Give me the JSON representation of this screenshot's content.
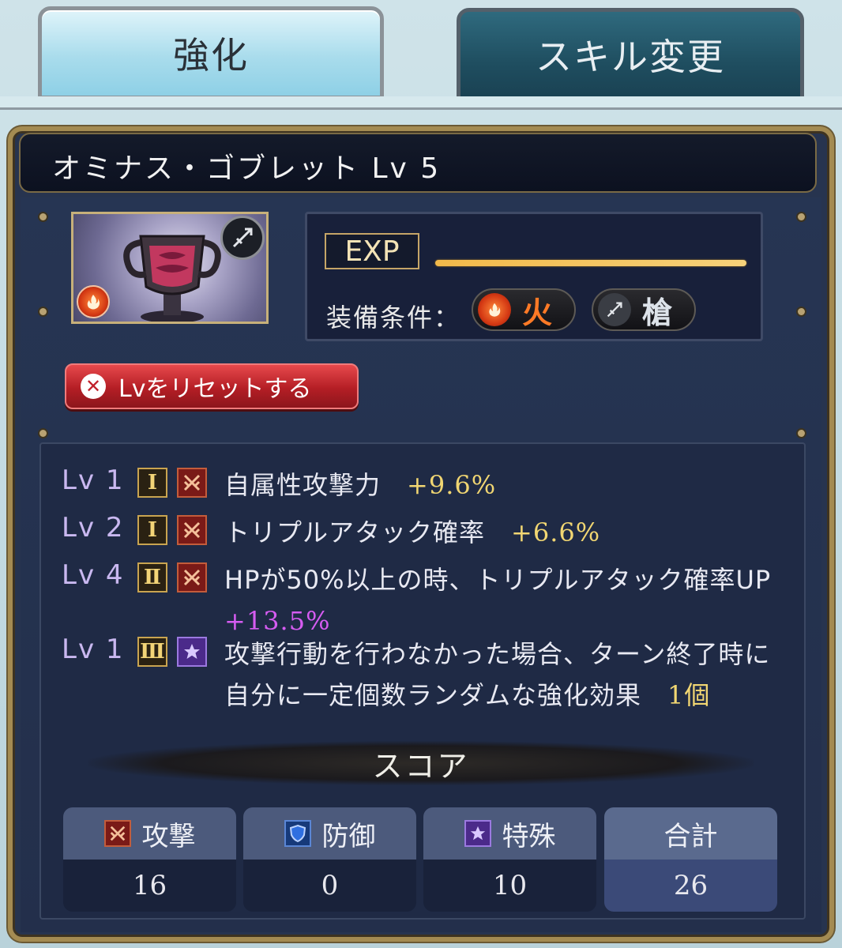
{
  "tabs": [
    {
      "label": "強化",
      "active": true
    },
    {
      "label": "スキル変更",
      "active": false
    }
  ],
  "item": {
    "name": "オミナス・ゴブレット Lv 5",
    "weapon_icon": "spear-icon",
    "element_icon": "fire-icon"
  },
  "exp": {
    "label": "EXP",
    "progress": 1.0
  },
  "equip": {
    "label": "装備条件：",
    "conditions": [
      {
        "icon": "fire-icon",
        "label": "火",
        "color": "#ff7a26"
      },
      {
        "icon": "spear-icon",
        "label": "槍",
        "color": "#dde3ea"
      }
    ]
  },
  "reset_button": {
    "label": "Lvをリセットする"
  },
  "skills": [
    {
      "level": "Lv 1",
      "rank": "Ⅰ",
      "type": "attack",
      "text": "自属性攻撃力",
      "value": "+9.6%",
      "value_color": "gold"
    },
    {
      "level": "Lv 2",
      "rank": "Ⅰ",
      "type": "attack",
      "text": "トリプルアタック確率",
      "value": "+6.6%",
      "value_color": "gold"
    },
    {
      "level": "Lv 4",
      "rank": "Ⅱ",
      "type": "attack",
      "text": "HPが50%以上の時、トリプルアタック確率UP",
      "value": "+13.5%",
      "value_color": "purple"
    },
    {
      "level": "Lv 1",
      "rank": "Ⅲ",
      "type": "special",
      "text": "攻撃行動を行わなかった場合、ターン終了時に自分に一定個数ランダムな強化効果",
      "value": "1個",
      "value_color": "gold"
    }
  ],
  "score": {
    "title": "スコア",
    "columns": [
      {
        "label": "攻撃",
        "icon": "attack-icon",
        "value": "16"
      },
      {
        "label": "防御",
        "icon": "shield-icon",
        "value": "0"
      },
      {
        "label": "特殊",
        "icon": "star-icon",
        "value": "10"
      },
      {
        "label": "合計",
        "icon": "",
        "value": "26"
      }
    ]
  }
}
